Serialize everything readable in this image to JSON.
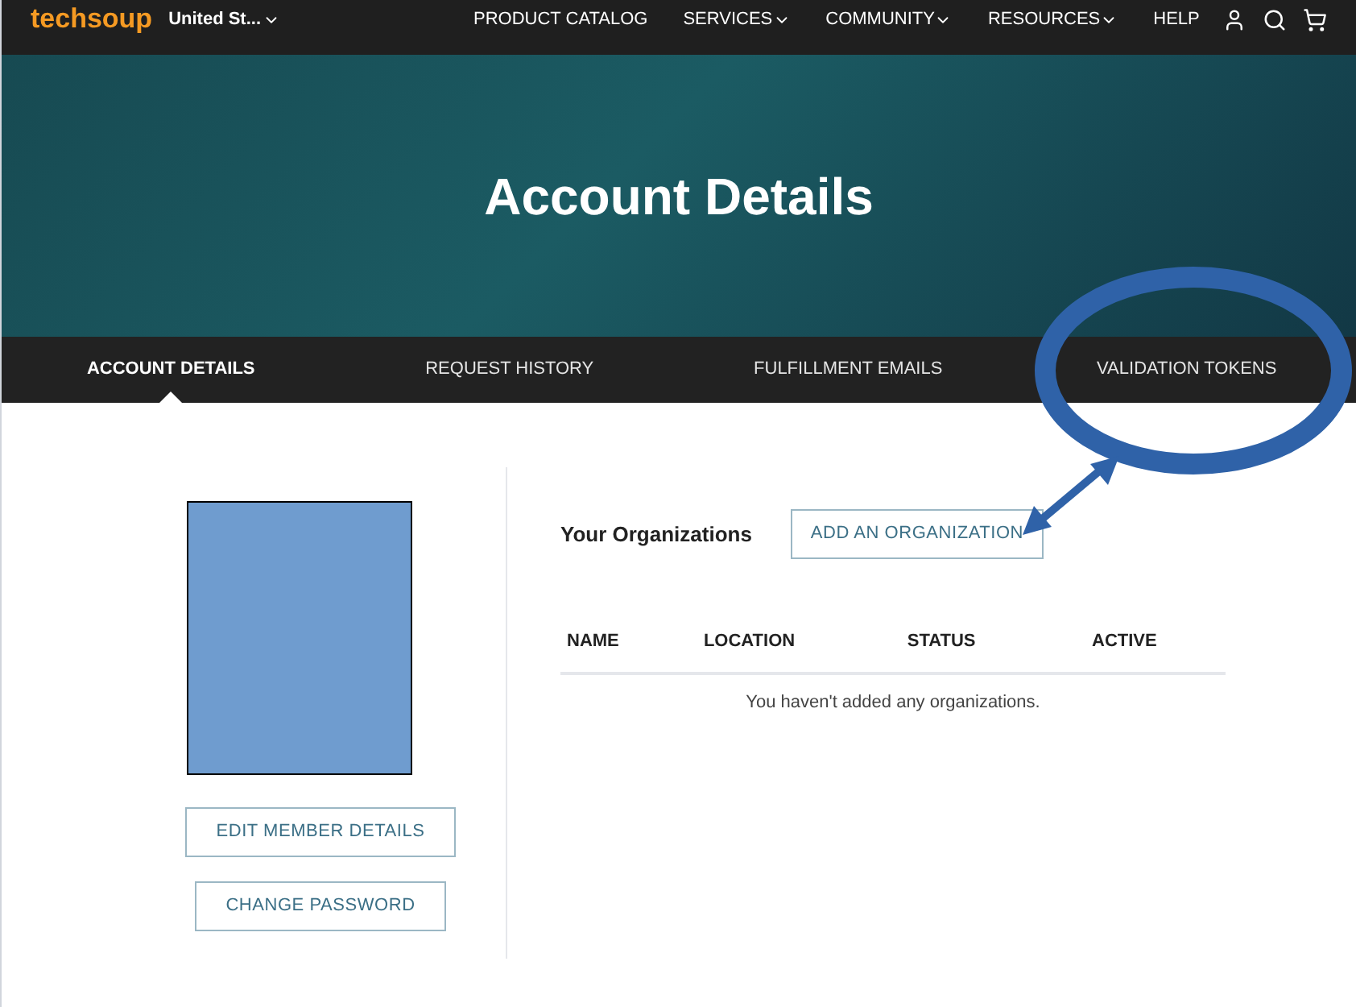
{
  "top_nav": {
    "logo": "techsoup",
    "region": "United St...",
    "items": [
      {
        "label": "PRODUCT CATALOG",
        "has_menu": false
      },
      {
        "label": "SERVICES",
        "has_menu": true
      },
      {
        "label": "COMMUNITY",
        "has_menu": true
      },
      {
        "label": "RESOURCES",
        "has_menu": true
      },
      {
        "label": "HELP",
        "has_menu": false
      }
    ]
  },
  "hero": {
    "title": "Account Details"
  },
  "tabs": [
    {
      "label": "ACCOUNT DETAILS",
      "selected": true
    },
    {
      "label": "REQUEST HISTORY",
      "selected": false
    },
    {
      "label": "FULFILLMENT EMAILS",
      "selected": false
    },
    {
      "label": "VALIDATION TOKENS",
      "selected": false
    }
  ],
  "profile": {
    "buttons": [
      "EDIT MEMBER DETAILS",
      "CHANGE PASSWORD"
    ]
  },
  "organizations": {
    "heading": "Your Organizations",
    "add_button": "ADD AN ORGANIZATION",
    "columns": [
      "NAME",
      "LOCATION",
      "STATUS",
      "ACTIVE"
    ],
    "empty_message": "You haven't added any organizations."
  }
}
